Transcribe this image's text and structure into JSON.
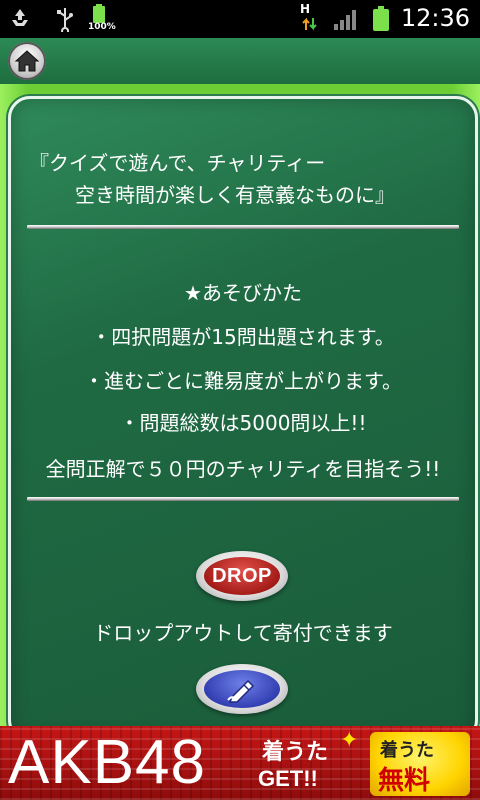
{
  "status_bar": {
    "battery_label": "100%",
    "network_label": "H",
    "time": "12:36",
    "icons": [
      "recycle-icon",
      "usb-icon",
      "battery-small-icon",
      "data-arrows-icon",
      "signal-icon",
      "battery-icon"
    ]
  },
  "title_bar": {
    "home_icon": "home-icon"
  },
  "intro": {
    "line1": "『クイズで遊んで、チャリティー",
    "line2": "空き時間が楽しく有意義なものに』"
  },
  "howto": {
    "heading": "★あそびかた",
    "item1": "・四択問題が15問出題されます。",
    "item2": "・進むごとに難易度が上がります。",
    "item3": "・問題総数は5000問以上!!",
    "item4": "全問正解で５０円のチャリティを目指そう!!"
  },
  "drop": {
    "button_label": "DROP",
    "caption": "ドロップアウトして寄付できます"
  },
  "edit": {
    "icon": "pencil-icon"
  },
  "ad": {
    "main_text": "AKB48",
    "sub1": "着うた",
    "sub2": "GET!!",
    "badge_line1": "着うた",
    "badge_line2": "無料"
  },
  "colors": {
    "board": "#1f6a43",
    "frame_green": "#6ccd34",
    "drop_red": "#a41c18",
    "edit_blue": "#3340b3",
    "ad_red": "#b01010",
    "badge_yellow": "#ffd400"
  }
}
